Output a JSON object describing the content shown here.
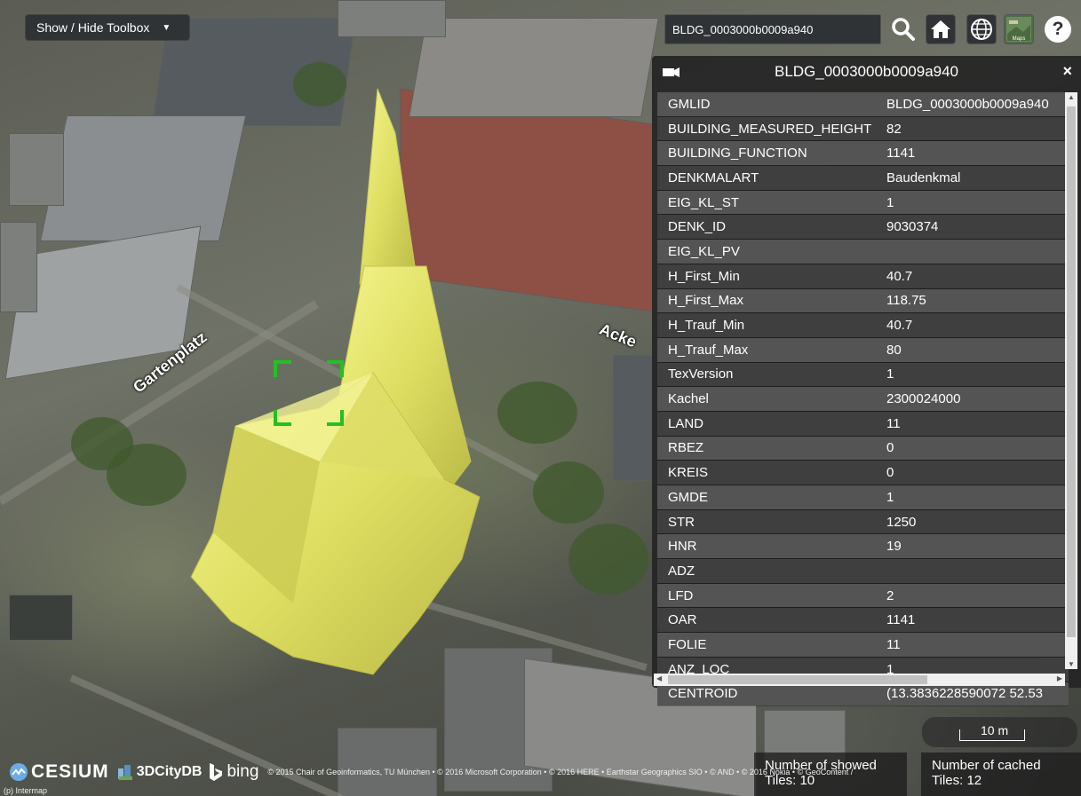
{
  "toolbox": {
    "toggle_label": "Show / Hide Toolbox",
    "arrow": "▼"
  },
  "search": {
    "value": "BLDG_0003000b0009a940"
  },
  "toolbar": {
    "help_label": "?",
    "layers_caption": "Maps"
  },
  "map": {
    "street_labels": [
      "Gartenplatz",
      "Acke"
    ]
  },
  "infobox": {
    "title": "BLDG_0003000b0009a940",
    "close_label": "×",
    "rows": [
      {
        "key": "GMLID",
        "value": "BLDG_0003000b0009a940"
      },
      {
        "key": "BUILDING_MEASURED_HEIGHT",
        "value": "82"
      },
      {
        "key": "BUILDING_FUNCTION",
        "value": "1141"
      },
      {
        "key": "DENKMALART",
        "value": "Baudenkmal"
      },
      {
        "key": "EIG_KL_ST",
        "value": "1"
      },
      {
        "key": "DENK_ID",
        "value": "9030374"
      },
      {
        "key": "EIG_KL_PV",
        "value": ""
      },
      {
        "key": "H_First_Min",
        "value": "40.7"
      },
      {
        "key": "H_First_Max",
        "value": "118.75"
      },
      {
        "key": "H_Trauf_Min",
        "value": "40.7"
      },
      {
        "key": "H_Trauf_Max",
        "value": "80"
      },
      {
        "key": "TexVersion",
        "value": "1"
      },
      {
        "key": "Kachel",
        "value": "2300024000"
      },
      {
        "key": "LAND",
        "value": "11"
      },
      {
        "key": "RBEZ",
        "value": "0"
      },
      {
        "key": "KREIS",
        "value": "0"
      },
      {
        "key": "GMDE",
        "value": "1"
      },
      {
        "key": "STR",
        "value": "1250"
      },
      {
        "key": "HNR",
        "value": "19"
      },
      {
        "key": "ADZ",
        "value": ""
      },
      {
        "key": "LFD",
        "value": "2"
      },
      {
        "key": "OAR",
        "value": "1141"
      },
      {
        "key": "FOLIE",
        "value": "11"
      },
      {
        "key": "ANZ_LOC",
        "value": "1"
      },
      {
        "key": "CENTROID",
        "value": "(13.3836228590072 52.53"
      }
    ]
  },
  "scale": {
    "label": "10 m"
  },
  "tiles": {
    "showed_line1": "Number of showed",
    "showed_line2": "Tiles: 10",
    "cached_line1": "Number of cached",
    "cached_line2": "Tiles: 12"
  },
  "credits": {
    "cesium": "CESIUM",
    "citydb": "3DCityDB",
    "bing": "bing",
    "text": "© 2015 Chair of Geoinformatics, TU München • © 2016 Microsoft Corporation • © 2016 HERE • Earthstar Geographics SIO • © AND • © 2016 Nokia • © GeoContent /",
    "line2": "(p) Intermap"
  },
  "colors": {
    "panel": "#262626",
    "row_odd": "#545454",
    "row_even": "#3f3f3f",
    "building_highlight": "#eef07a",
    "selection": "#22c122"
  }
}
